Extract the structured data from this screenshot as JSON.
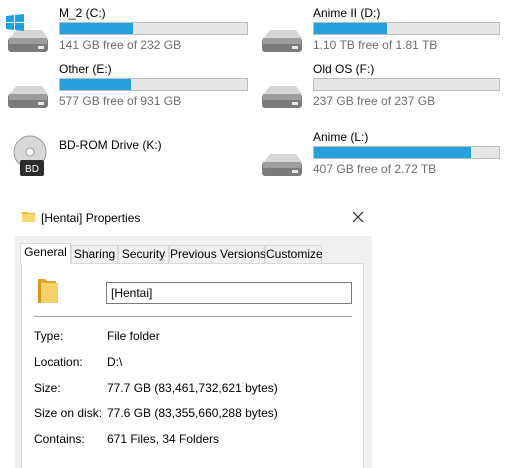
{
  "drives": [
    {
      "name": "M_2 (C:)",
      "free": "141 GB free of 232 GB",
      "used_fraction": 0.392,
      "icon": "windows-drive-icon"
    },
    {
      "name": "Anime II (D:)",
      "free": "1.10 TB free of 1.81 TB",
      "used_fraction": 0.392,
      "icon": "hard-drive-icon"
    },
    {
      "name": "Other (E:)",
      "free": "577 GB free of 931 GB",
      "used_fraction": 0.38,
      "icon": "hard-drive-icon"
    },
    {
      "name": "Old OS (F:)",
      "free": "237 GB free of 237 GB",
      "used_fraction": 0.0,
      "icon": "hard-drive-icon"
    },
    {
      "name": "BD-ROM Drive (K:)",
      "icon": "bd-rom-drive-icon",
      "icon_text": "BD"
    },
    {
      "name": "Anime (L:)",
      "free": "407 GB free of 2.72 TB",
      "used_fraction": 0.85,
      "icon": "hard-drive-icon"
    }
  ],
  "colors": {
    "bar_fill": "#26a0da",
    "bar_track": "#e6e6e6",
    "free_text": "#6d6d6d",
    "dialog_bg": "#f0f0f0"
  },
  "dialog": {
    "title": "[Hentai] Properties",
    "tabs": [
      "General",
      "Sharing",
      "Security",
      "Previous Versions",
      "Customize"
    ],
    "active_tab": "General",
    "name_value": "[Hentai]",
    "properties": [
      {
        "label": "Type:",
        "value": "File folder"
      },
      {
        "label": "Location:",
        "value": "D:\\"
      },
      {
        "label": "Size:",
        "value": "77.7 GB (83,461,732,621 bytes)"
      },
      {
        "label": "Size on disk:",
        "value": "77.6 GB (83,355,660,288 bytes)"
      },
      {
        "label": "Contains:",
        "value": "671 Files, 34 Folders"
      }
    ]
  }
}
